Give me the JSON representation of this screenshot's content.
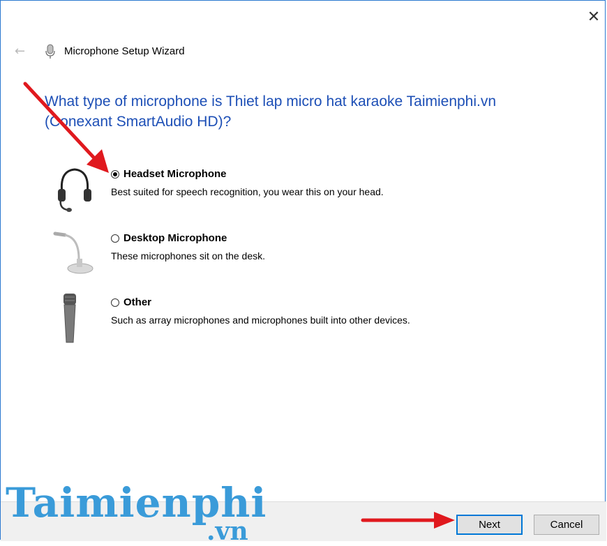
{
  "window": {
    "title": "Microphone Setup Wizard",
    "close_glyph": "✕",
    "back_glyph": "←",
    "title_icon": "microphone-icon"
  },
  "question": "What type of microphone is Thiet lap micro hat karaoke Taimienphi.vn (Conexant SmartAudio HD)?",
  "options": [
    {
      "label": "Headset Microphone",
      "description": "Best suited for speech recognition, you wear this on your head.",
      "selected": true,
      "icon": "headset-icon"
    },
    {
      "label": "Desktop Microphone",
      "description": "These microphones sit on the desk.",
      "selected": false,
      "icon": "desktop-microphone-icon"
    },
    {
      "label": "Other",
      "description": "Such as array microphones and microphones built into other devices.",
      "selected": false,
      "icon": "handheld-microphone-icon"
    }
  ],
  "buttons": {
    "next": "Next",
    "cancel": "Cancel"
  },
  "watermark": {
    "brand": "Taimienphi",
    "suffix": ".vn"
  },
  "colors": {
    "accent": "#0078d7",
    "question_text": "#1d4fb6",
    "annotation_arrow": "#e0191e",
    "watermark": "#3a9bd9"
  }
}
